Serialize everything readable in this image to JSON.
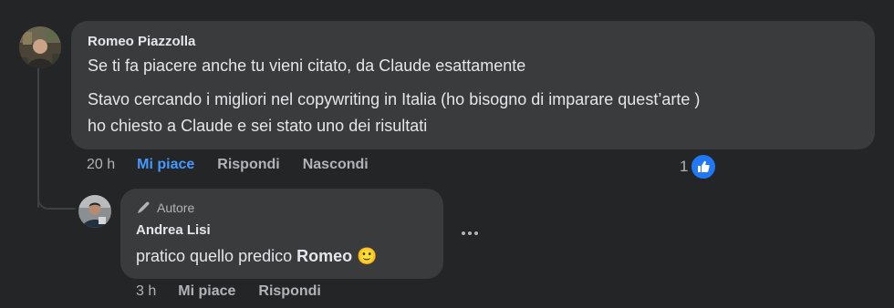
{
  "comment": {
    "author": "Romeo Piazzolla",
    "line1": "Se ti fa piacere anche tu vieni citato, da Claude esattamente",
    "para2_line1": "Stavo cercando i migliori nel copywriting in Italia (ho bisogno di imparare quest’arte )",
    "para2_line2": "ho chiesto a Claude e sei stato uno dei risultati",
    "time": "20 h",
    "like_label": "Mi piace",
    "reply_label": "Rispondi",
    "hide_label": "Nascondi",
    "reaction_count": "1",
    "reaction_icon": "thumbs-up-icon"
  },
  "reply": {
    "badge_label": "Autore",
    "badge_icon": "pen-icon",
    "author": "Andrea Lisi",
    "text_prefix": "pratico quello predico ",
    "mention": "Romeo",
    "emoji": "🙂",
    "time": "3 h",
    "like_label": "Mi piace",
    "reply_label": "Rispondi",
    "more_icon": "more-options-icon"
  },
  "colors": {
    "background": "#242526",
    "bubble": "#3a3b3c",
    "text": "#e4e6eb",
    "secondary": "#b0b3b8",
    "liked_blue": "#4599ff",
    "like_badge": "#2078f4"
  }
}
